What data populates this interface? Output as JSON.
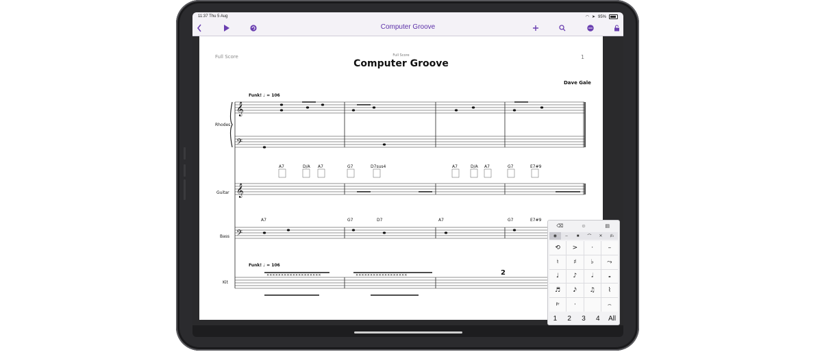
{
  "status_bar": {
    "time": "11:37",
    "date": "Thu 5 Aug",
    "battery": "95%"
  },
  "toolbar": {
    "title": "Computer Groove",
    "icons": [
      "chevron-left-icon",
      "play-icon",
      "undo-icon",
      "plus-icon",
      "search-icon",
      "more-icon",
      "lock-icon"
    ]
  },
  "score": {
    "header_left": "Full Score",
    "header_small": "Full Score",
    "title": "Computer Groove",
    "page_number": "1",
    "composer": "Dave Gale",
    "tempo": "Funk! ♩ = 106",
    "tempo_kit": "Funk! ♩ = 106",
    "instruments": [
      "Rhodes",
      "Guitar",
      "Bass",
      "Kit"
    ],
    "guitar_chords_1": [
      "A7",
      "D/A",
      "A7",
      "G7",
      "D7sus4"
    ],
    "guitar_chords_2": [
      "A7",
      "D/A",
      "A7",
      "G7",
      "E7#9"
    ],
    "bass_chords": [
      "A7",
      "G7",
      "D7",
      "A7",
      "G7",
      "E7#9"
    ],
    "kit_repeat": "2"
  },
  "palette": {
    "tabs": [
      "⌫",
      "☺",
      "▤"
    ],
    "subtabs": [
      "◉",
      "–",
      "■",
      "⌒",
      "✕",
      "♯♭"
    ],
    "grid": [
      "⟲",
      ">",
      "·",
      "–",
      "♮",
      "♯",
      "♭",
      "⤳",
      "♩",
      "♪",
      "𝅗𝅥",
      "𝅝",
      "♬",
      "𝅘𝅥𝅯",
      "♫",
      "⌇",
      "𝄽𝄾",
      "·",
      "",
      "⌢"
    ],
    "voices": [
      "1",
      "2",
      "3",
      "4",
      "All"
    ]
  },
  "colors": {
    "accent": "#6a3fb0",
    "ipad_body": "#2b2b2e",
    "paper": "#ffffff",
    "toolbar": "#f4f2f7"
  }
}
